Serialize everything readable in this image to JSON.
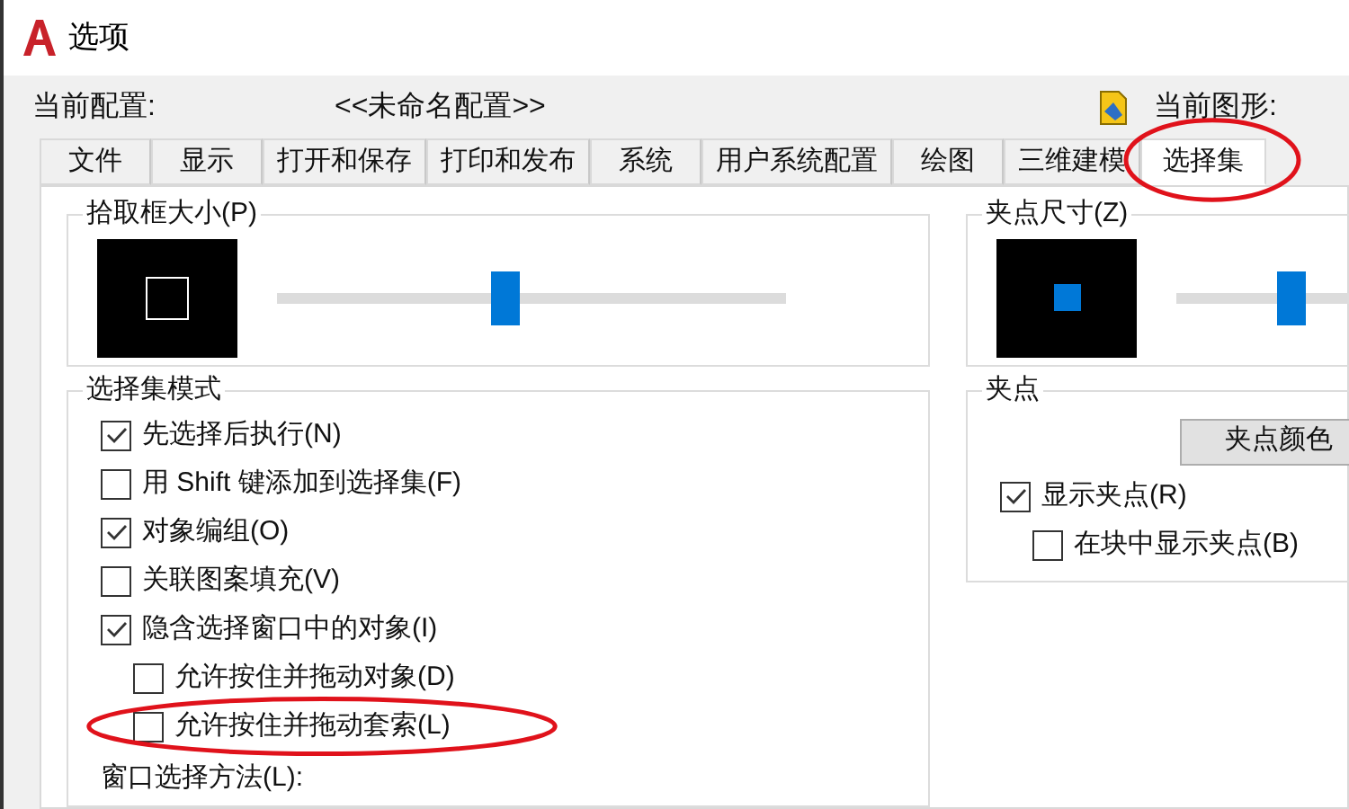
{
  "window": {
    "title": "选项"
  },
  "profile": {
    "label": "当前配置:",
    "value": "<<未命名配置>>",
    "drawing_label": "当前图形:"
  },
  "tabs": [
    {
      "label": "文件",
      "selected": false,
      "highlighted": false
    },
    {
      "label": "显示",
      "selected": false,
      "highlighted": false
    },
    {
      "label": "打开和保存",
      "selected": false,
      "highlighted": false
    },
    {
      "label": "打印和发布",
      "selected": false,
      "highlighted": false
    },
    {
      "label": "系统",
      "selected": false,
      "highlighted": false
    },
    {
      "label": "用户系统配置",
      "selected": false,
      "highlighted": false
    },
    {
      "label": "绘图",
      "selected": false,
      "highlighted": false
    },
    {
      "label": "三维建模",
      "selected": false,
      "highlighted": false
    },
    {
      "label": "选择集",
      "selected": true,
      "highlighted": true
    }
  ],
  "pickbox": {
    "title": "拾取框大小(P)",
    "level": 0.45
  },
  "selection_modes": {
    "title": "选择集模式",
    "items": [
      {
        "label": "先选择后执行(N)",
        "checked": true,
        "highlighted": false
      },
      {
        "label": "用 Shift 键添加到选择集(F)",
        "checked": false,
        "highlighted": false
      },
      {
        "label": "对象编组(O)",
        "checked": true,
        "highlighted": false
      },
      {
        "label": "关联图案填充(V)",
        "checked": false,
        "highlighted": false
      },
      {
        "label": "隐含选择窗口中的对象(I)",
        "checked": true,
        "highlighted": false,
        "children": [
          {
            "label": "允许按住并拖动对象(D)",
            "checked": false,
            "highlighted": false
          },
          {
            "label": "允许按住并拖动套索(L)",
            "checked": false,
            "highlighted": true
          }
        ]
      }
    ],
    "window_method_label": "窗口选择方法(L):"
  },
  "grip_size": {
    "title": "夹点尺寸(Z)",
    "level": 0.67
  },
  "grips": {
    "title": "夹点",
    "button": "夹点颜色",
    "items": [
      {
        "label": "显示夹点(R)",
        "checked": true,
        "highlighted": false,
        "children": [
          {
            "label": "在块中显示夹点(B)",
            "checked": false,
            "highlighted": false
          }
        ]
      }
    ]
  }
}
